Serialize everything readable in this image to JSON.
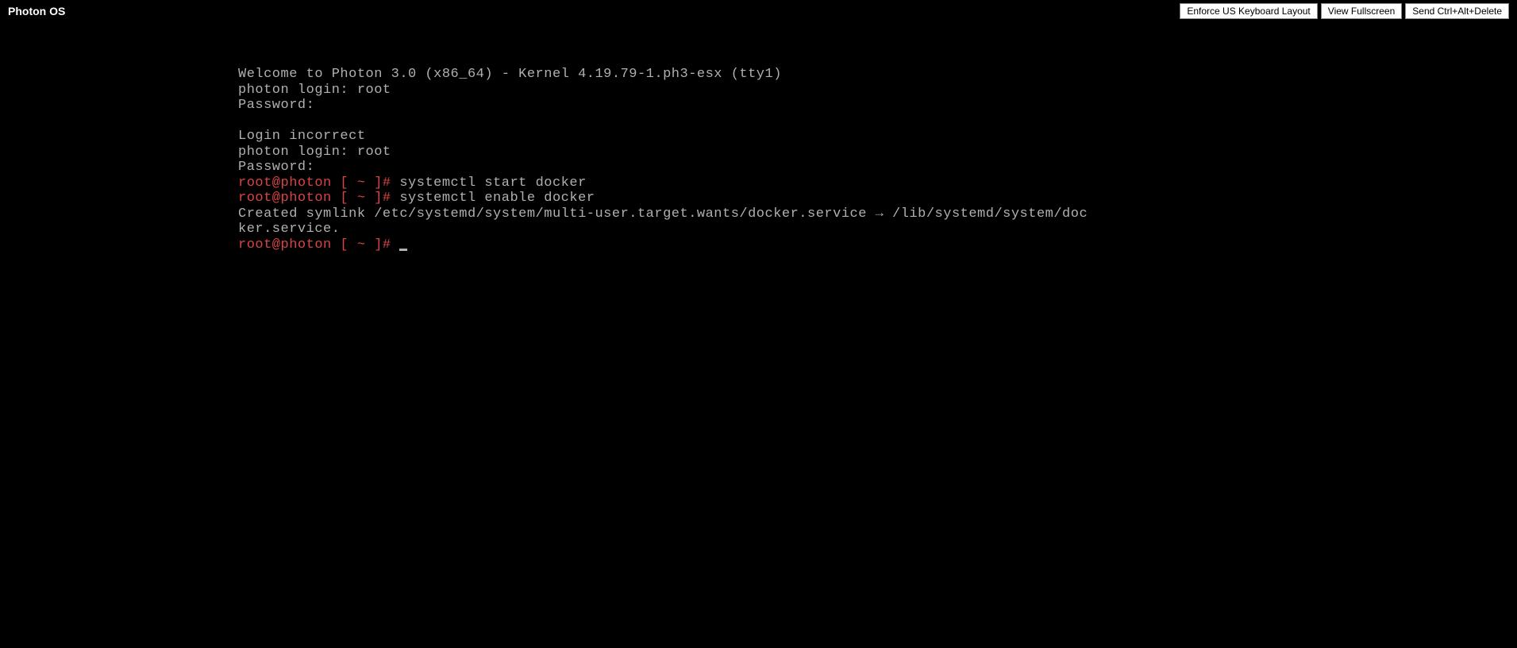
{
  "header": {
    "title": "Photon OS",
    "buttons": {
      "enforce_kb": "Enforce US Keyboard Layout",
      "view_fullscreen": "View Fullscreen",
      "send_cad": "Send Ctrl+Alt+Delete"
    }
  },
  "terminal": {
    "welcome": "Welcome to Photon 3.0 (x86_64) - Kernel 4.19.79-1.ph3-esx (tty1)",
    "login1": "photon login: root",
    "password1": "Password:",
    "blank1": "",
    "login_incorrect": "Login incorrect",
    "login2": "photon login: root",
    "password2": "Password:",
    "prompt1": "root@photon [ ~ ]#",
    "cmd1": " systemctl start docker",
    "prompt2": "root@photon [ ~ ]#",
    "cmd2": " systemctl enable docker",
    "symlink": "Created symlink /etc/systemd/system/multi-user.target.wants/docker.service → /lib/systemd/system/doc\nker.service.",
    "prompt3": "root@photon [ ~ ]#",
    "cmd3": " "
  }
}
